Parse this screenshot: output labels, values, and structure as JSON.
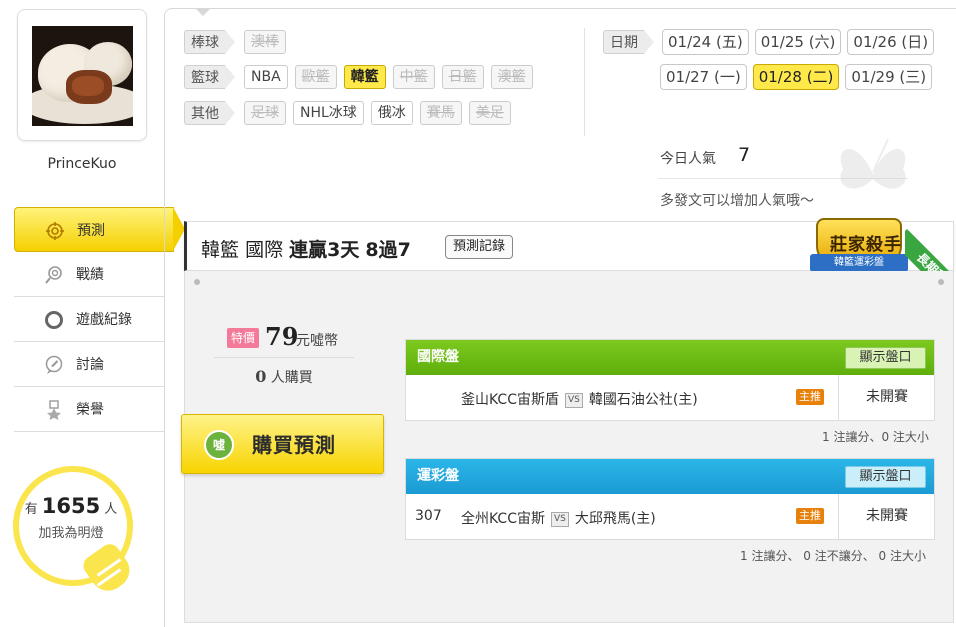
{
  "user": {
    "name": "PrinceKuo",
    "fans_prefix": "有",
    "fans_count": "1655",
    "fans_suffix": "人",
    "fans_action": "加我為明燈"
  },
  "menu": [
    {
      "label": "預測",
      "icon": "target-icon",
      "active": true
    },
    {
      "label": "戰績",
      "icon": "record-icon",
      "active": false
    },
    {
      "label": "遊戲紀錄",
      "icon": "circle-icon",
      "active": false
    },
    {
      "label": "討論",
      "icon": "chat-icon",
      "active": false
    },
    {
      "label": "榮譽",
      "icon": "medal-icon",
      "active": false
    }
  ],
  "filters": {
    "baseball": {
      "label": "棒球",
      "items": [
        {
          "label": "澳棒",
          "disabled": true
        }
      ]
    },
    "basketball": {
      "label": "籃球",
      "items": [
        {
          "label": "NBA",
          "disabled": false
        },
        {
          "label": "歐籃",
          "disabled": true
        },
        {
          "label": "韓籃",
          "selected": true
        },
        {
          "label": "中籃",
          "disabled": true
        },
        {
          "label": "日籃",
          "disabled": true
        },
        {
          "label": "澳籃",
          "disabled": true
        }
      ]
    },
    "other": {
      "label": "其他",
      "items": [
        {
          "label": "足球",
          "disabled": true
        },
        {
          "label": "NHL冰球",
          "disabled": false
        },
        {
          "label": "俄冰",
          "disabled": false
        },
        {
          "label": "賽馬",
          "disabled": true
        },
        {
          "label": "美足",
          "disabled": true
        }
      ]
    }
  },
  "dates": {
    "label": "日期",
    "row1": [
      "01/24 (五)",
      "01/25 (六)",
      "01/26 (日)"
    ],
    "row2": [
      "01/27 (一)",
      "01/28 (二)",
      "01/29 (三)"
    ],
    "selected": "01/28 (二)"
  },
  "popularity": {
    "label": "今日人氣",
    "value": "7",
    "tip": "多發文可以增加人氣哦～"
  },
  "record": {
    "league": "韓籃",
    "type": "國際",
    "streak": "連贏3天",
    "score": "8過7",
    "button": "預測記錄",
    "badge_title": "莊家殺手",
    "badge_sub": "韓籃運彩盤",
    "corner": "長期穩"
  },
  "purchase": {
    "tag": "特價",
    "price": "79",
    "unit": "元噓幣",
    "buyers": "0",
    "buyers_suffix": "人購買",
    "button_icon": "噓",
    "button": "購買預測"
  },
  "boards": {
    "international": {
      "title": "國際盤",
      "show_button": "顯示盤口",
      "game_no": "",
      "away": "釜山KCC宙斯盾",
      "vs": "VS",
      "home": "韓國石油公社(主)",
      "tag": "主推",
      "status": "未開賽",
      "note": "1 注讓分、0 注大小"
    },
    "sports_lottery": {
      "title": "運彩盤",
      "show_button": "顯示盤口",
      "game_no": "307",
      "away": "全州KCC宙斯",
      "vs": "VS",
      "home": "大邱飛馬(主)",
      "tag": "主推",
      "status": "未開賽",
      "note": "1 注讓分、 0 注不讓分、 0 注大小"
    }
  },
  "colors": {
    "accent_yellow": "#ffe84a",
    "green_header": "#6ebd14",
    "blue_header": "#22a8de",
    "price_tag": "#f47a9a"
  }
}
